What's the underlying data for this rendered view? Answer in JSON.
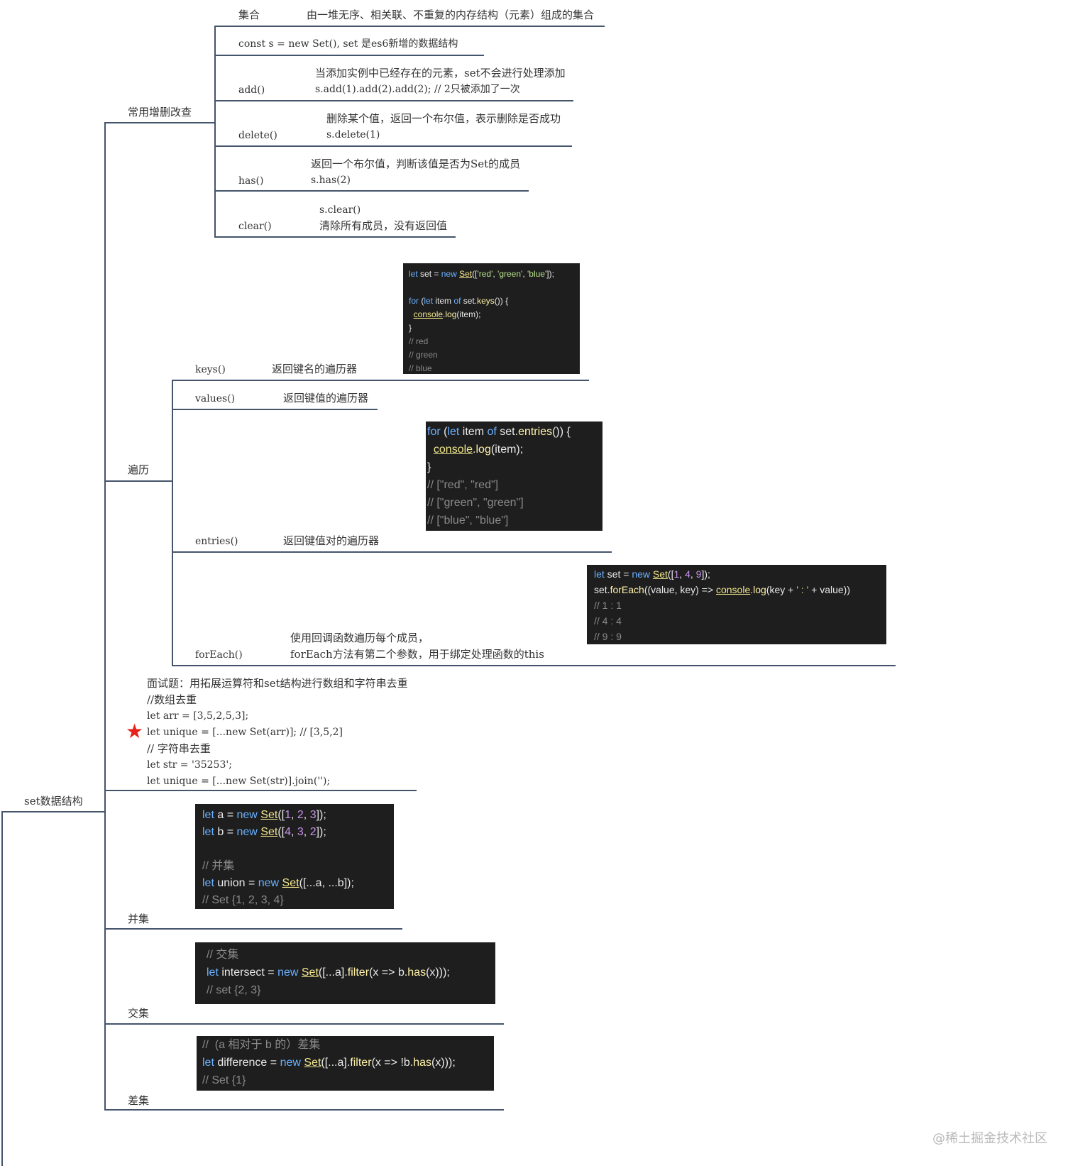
{
  "root": {
    "label": "set数据结构"
  },
  "crud": {
    "label": "常用增删改查",
    "set_term": "集合",
    "set_desc": "由一堆无序、相关联、不重复的内存结构（元素）组成的集合",
    "const_line": "const s = new Set(), set 是es6新增的数据结构",
    "add": {
      "label": "add()",
      "desc1": "当添加实例中已经存在的元素，set不会进行处理添加",
      "desc2": "s.add(1).add(2).add(2); // 2只被添加了一次"
    },
    "delete": {
      "label": "delete()",
      "desc1": "删除某个值，返回一个布尔值，表示删除是否成功",
      "desc2": "s.delete(1)"
    },
    "has": {
      "label": "has()",
      "desc1": "返回一个布尔值，判断该值是否为Set的成员",
      "desc2": "s.has(2)"
    },
    "clear": {
      "label": "clear()",
      "desc1": "s.clear()",
      "desc2": "清除所有成员，没有返回值"
    }
  },
  "traverse": {
    "label": "遍历",
    "keys": {
      "label": "keys()",
      "desc": "返回键名的遍历器"
    },
    "values": {
      "label": "values()",
      "desc": "返回键值的遍历器"
    },
    "entries": {
      "label": "entries()",
      "desc": "返回键值对的遍历器"
    },
    "foreach": {
      "label": "forEach()",
      "desc1": "使用回调函数遍历每个成员，",
      "desc2": "forEach方法有第二个参数，用于绑定处理函数的this"
    }
  },
  "interview": {
    "lines": [
      "面试题：用拓展运算符和set结构进行数组和字符串去重",
      "//数组去重",
      "let arr = [3,5,2,5,3];",
      "let unique = [...new Set(arr)]; // [3,5,2]",
      "// 字符串去重",
      "let str = '35253';",
      "let unique = [...new Set(str)].join('');"
    ],
    "star_icon": "star-icon"
  },
  "union": {
    "label": "并集"
  },
  "intersect": {
    "label": "交集"
  },
  "difference": {
    "label": "差集"
  },
  "watermark": "@稀土掘金技术社区"
}
